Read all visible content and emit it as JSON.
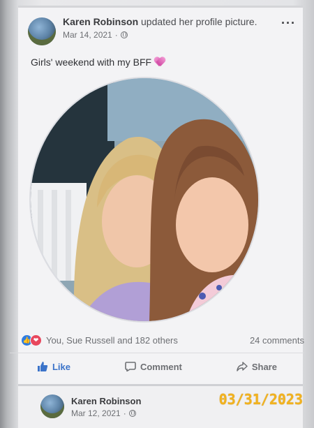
{
  "post": {
    "author": "Karen Robinson",
    "action": "updated her profile picture.",
    "date": "Mar 14, 2021",
    "privacy_icon": "globe-icon",
    "more_icon": "···",
    "caption": "Girls' weekend with my BFF",
    "caption_emoji": "sparkling-heart-icon",
    "reactions": {
      "icons": [
        "like-reaction-icon",
        "love-reaction-icon"
      ],
      "like_glyph": "👍",
      "love_glyph": "❤",
      "text": "You, Sue Russell and 182 others",
      "comments": "24 comments"
    },
    "actions": {
      "like": "Like",
      "comment": "Comment",
      "share": "Share"
    },
    "colors": {
      "like_blue": "#3b73c9",
      "love_red": "#e8475d",
      "date_stamp": "#f2b21e"
    }
  },
  "next_post": {
    "author": "Karen Robinson",
    "date": "Mar 12, 2021"
  },
  "date_stamp": "03/31/2023"
}
